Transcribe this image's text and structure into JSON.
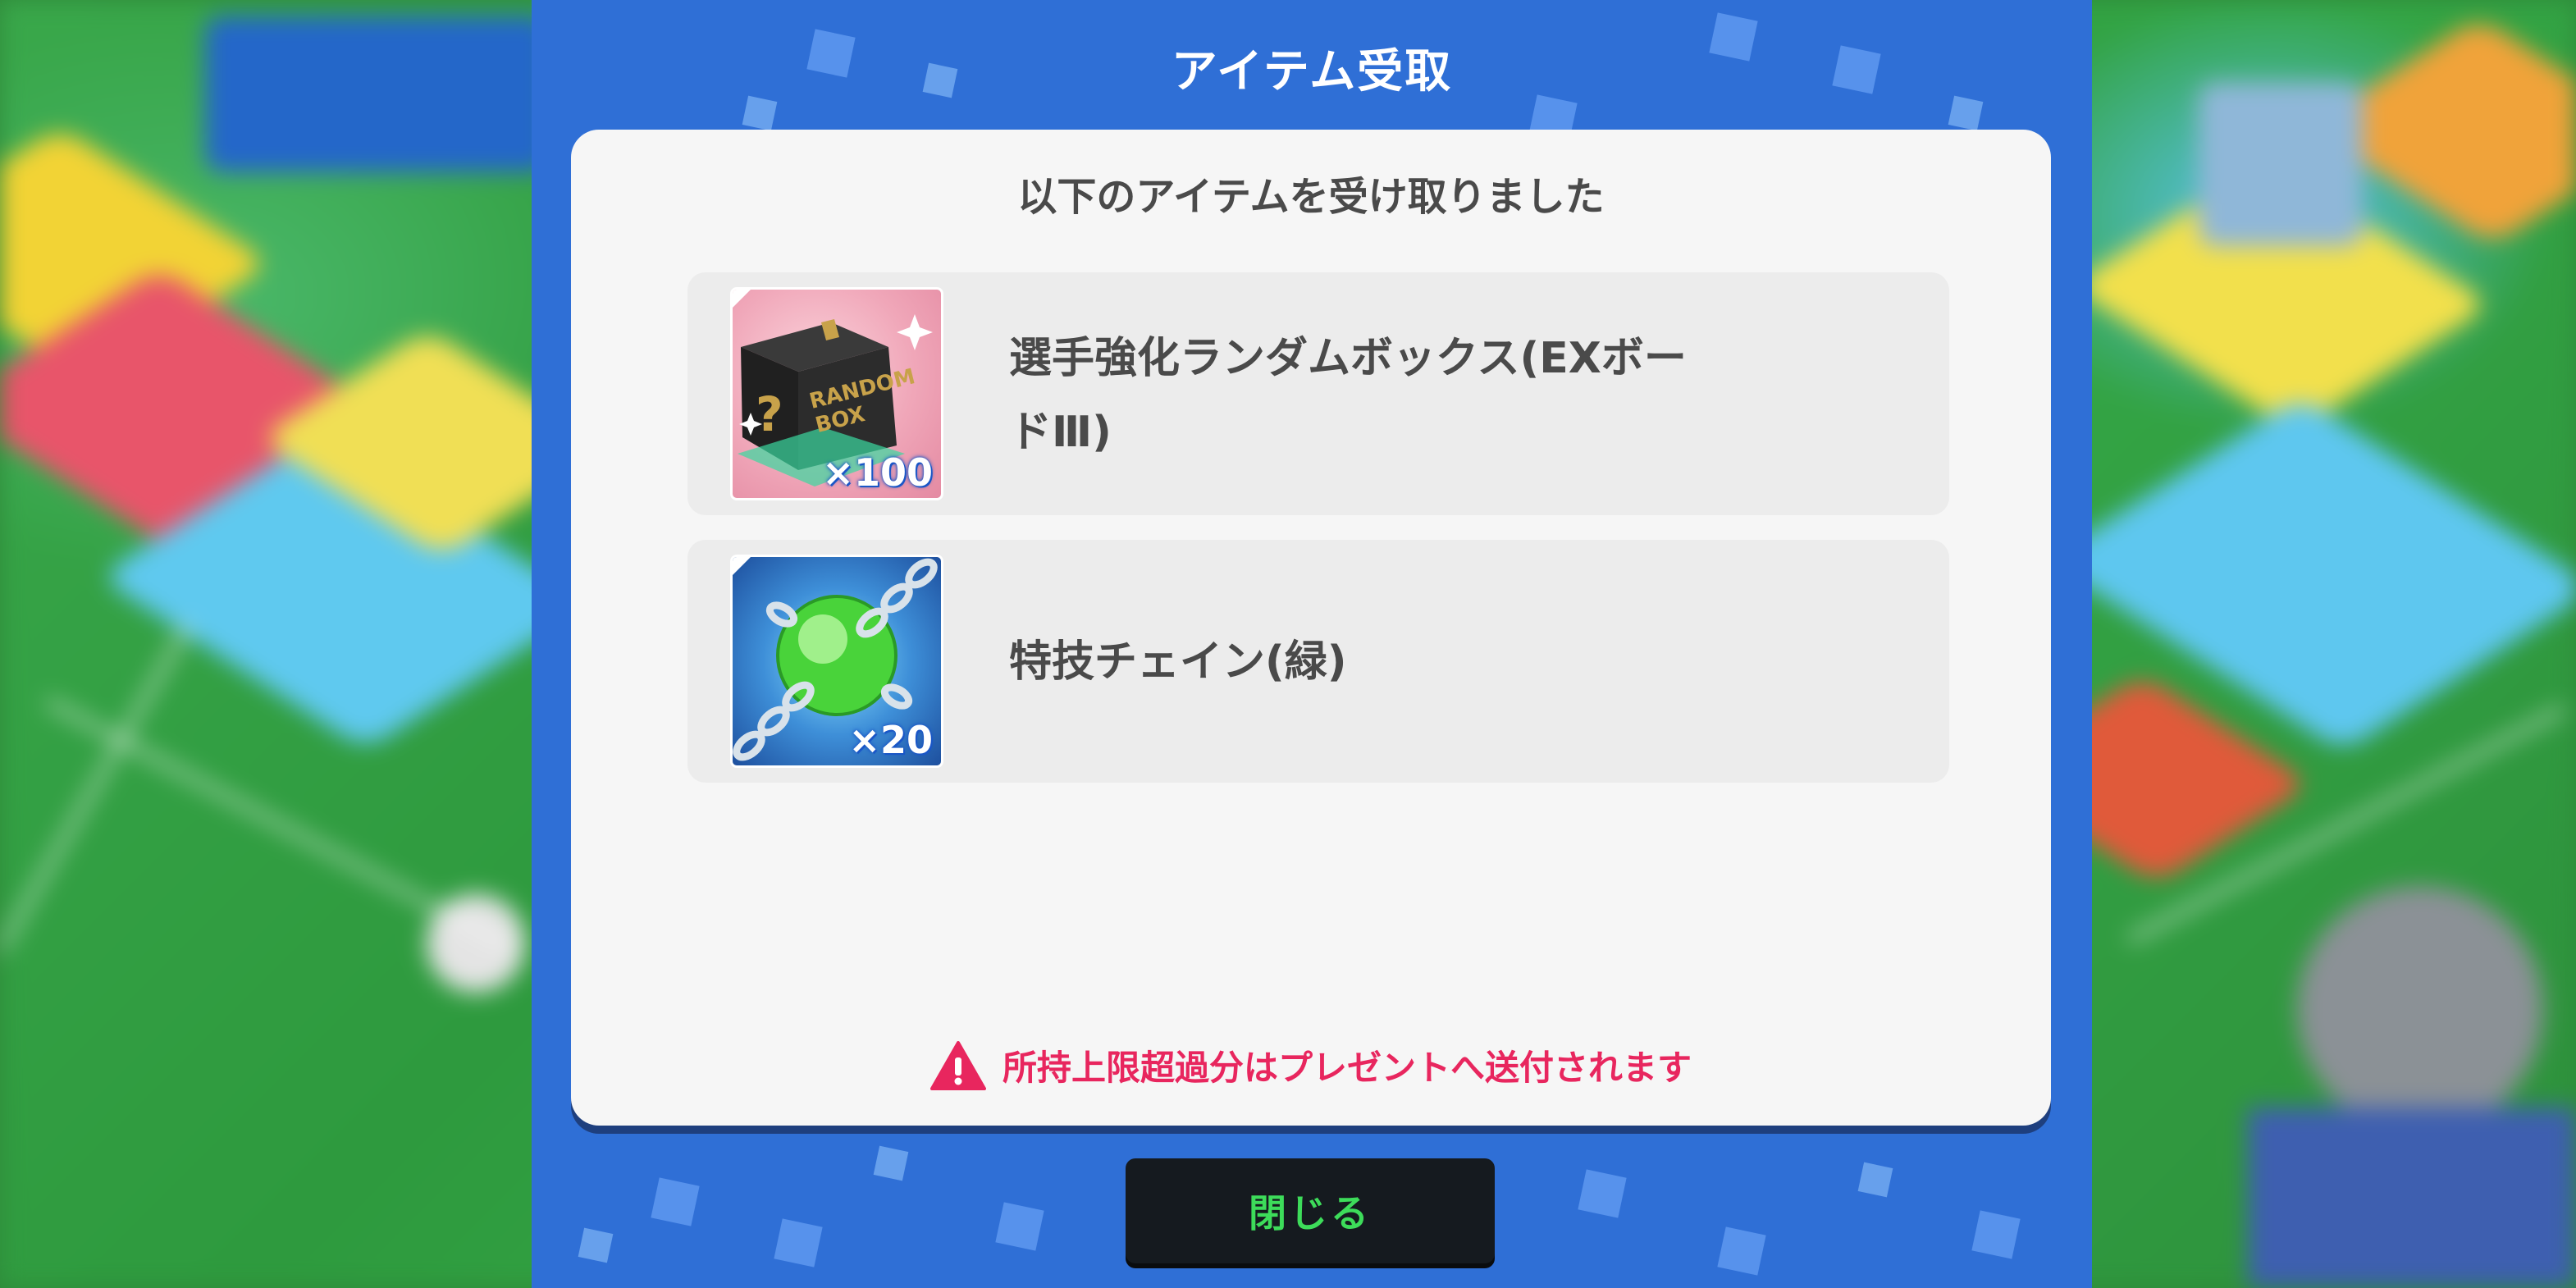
{
  "dialog": {
    "title": "アイテム受取",
    "subtitle": "以下のアイテムを受け取りました",
    "items": [
      {
        "icon": "random-box-icon",
        "quantity": "×100",
        "name_line1": "選手強化ランダムボックス(EXボー",
        "name_line2": "ドⅢ)"
      },
      {
        "icon": "chain-ball-icon",
        "quantity": "×20",
        "name_line1": "特技チェイン(緑)",
        "name_line2": ""
      }
    ],
    "warning": "所持上限超過分はプレゼントへ送付されます",
    "close_label": "閉じる",
    "random_box_text": [
      "RANDOM",
      "BOX"
    ]
  },
  "colors": {
    "frame": "#2f6fd6",
    "warning": "#e8265e",
    "button_text": "#3ddc5a"
  }
}
